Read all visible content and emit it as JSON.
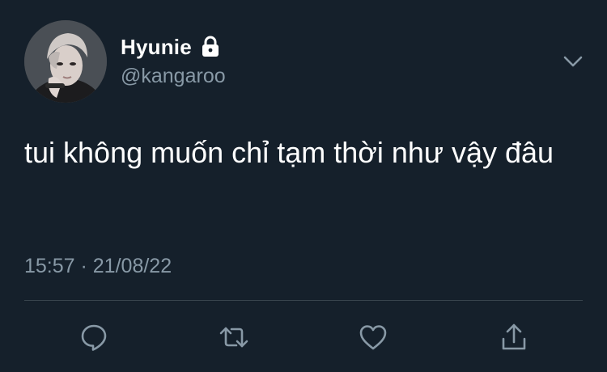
{
  "tweet": {
    "display_name": "Hyunie",
    "handle": "@kangaroo",
    "text": "tui không muốn chỉ tạm thời như vậy đâu",
    "time": "15:57",
    "separator": " · ",
    "date": "21/08/22"
  },
  "icons": {
    "lock": "lock-icon",
    "menu": "chevron-down-icon",
    "reply": "reply-icon",
    "retweet": "retweet-icon",
    "like": "heart-icon",
    "share": "share-icon"
  },
  "colors": {
    "background": "#15202b",
    "text": "#ffffff",
    "secondary_text": "#8899a6",
    "divider": "#38444d"
  }
}
